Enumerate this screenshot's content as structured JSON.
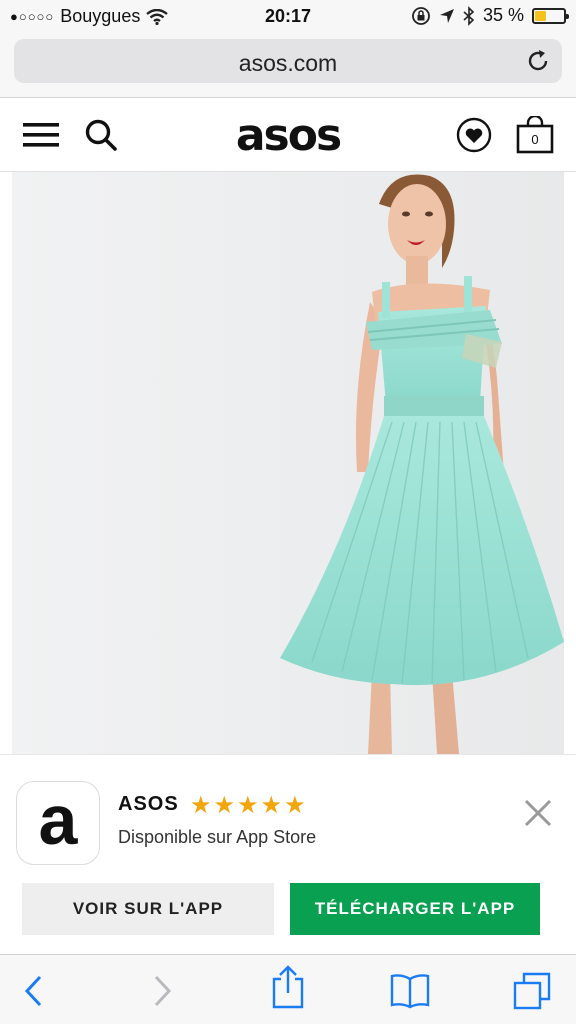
{
  "status_bar": {
    "signal": "●○○○○",
    "carrier": "Bouygues",
    "time": "20:17",
    "battery_percent": "35 %",
    "battery_level": 0.35
  },
  "browser": {
    "url": "asos.com"
  },
  "site": {
    "logo": "asos",
    "bag_count": "0"
  },
  "app_banner": {
    "icon_letter": "a",
    "app_name": "ASOS",
    "stars": "★★★★★",
    "rating": 5,
    "subtitle": "Disponible sur App Store",
    "view_button": "VOIR SUR L'APP",
    "download_button": "TÉLÉCHARGER L'APP"
  },
  "colors": {
    "accent_green": "#0aa052",
    "star_color": "#f2a60c",
    "ios_blue": "#1a7cf5",
    "dress_color": "#9fe3d6"
  },
  "icons": [
    "wifi-icon",
    "orientation-lock-icon",
    "location-arrow-icon",
    "bluetooth-icon",
    "battery-icon",
    "reload-icon",
    "menu-icon",
    "search-icon",
    "wishlist-heart-icon",
    "bag-icon",
    "close-icon",
    "back-icon",
    "forward-icon",
    "share-icon",
    "bookmarks-icon",
    "tabs-icon"
  ]
}
